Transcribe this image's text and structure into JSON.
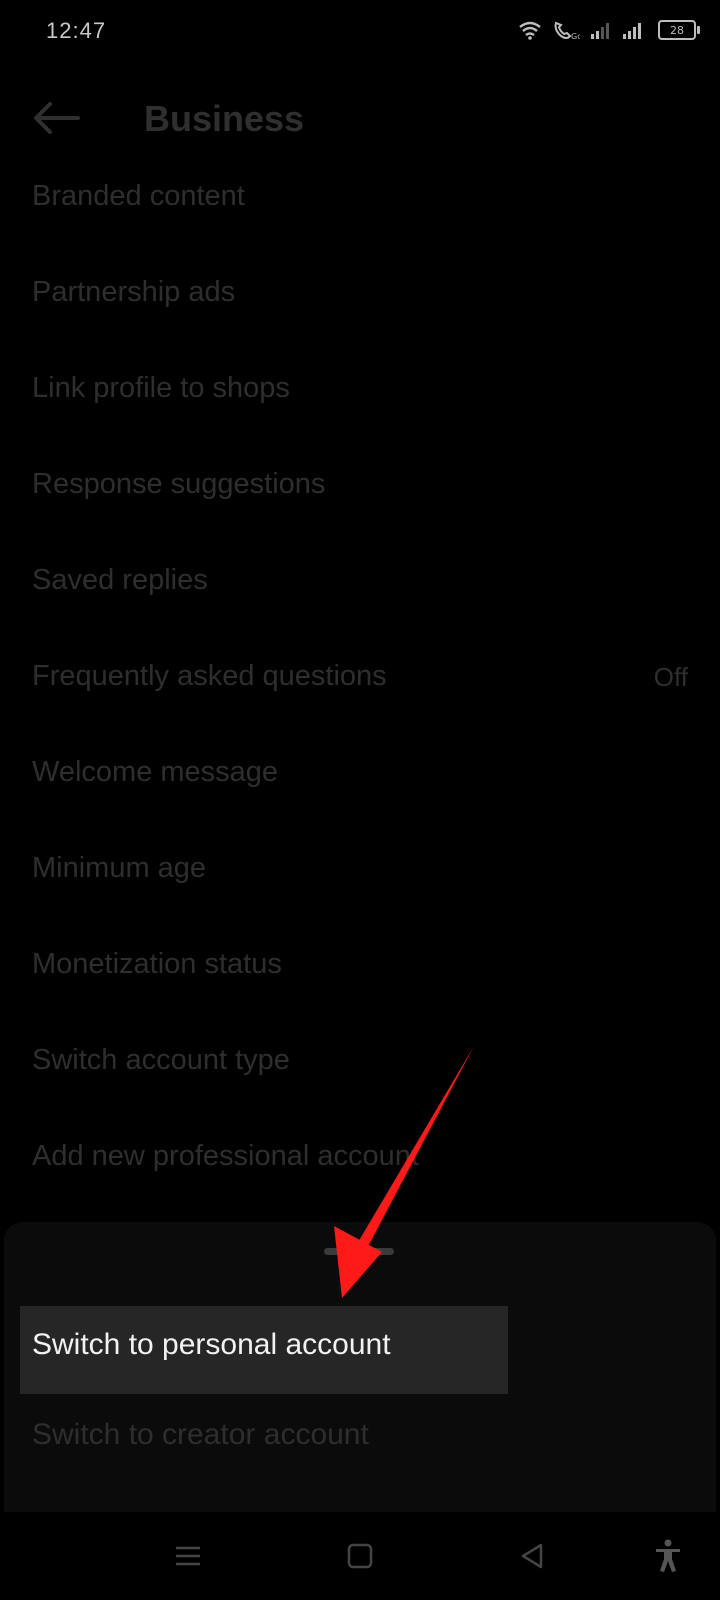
{
  "status_bar": {
    "time": "12:47",
    "battery": "28",
    "icons": [
      "wifi-icon",
      "volte-call-icon",
      "signal-icon",
      "signal-icon",
      "battery-icon"
    ]
  },
  "header": {
    "title": "Business",
    "back_icon": "arrow-left-icon"
  },
  "menu": {
    "items": [
      {
        "label": "Branded content"
      },
      {
        "label": "Partnership ads"
      },
      {
        "label": "Link profile to shops"
      },
      {
        "label": "Response suggestions"
      },
      {
        "label": "Saved replies"
      },
      {
        "label": "Frequently asked questions",
        "value": "Off"
      },
      {
        "label": "Welcome message"
      },
      {
        "label": "Minimum age"
      },
      {
        "label": "Monetization status"
      },
      {
        "label": "Switch account type"
      },
      {
        "label": "Add new professional account"
      }
    ]
  },
  "bottom_sheet": {
    "options": [
      {
        "label": "Switch to personal account"
      },
      {
        "label": "Switch to creator account"
      }
    ]
  },
  "annotation": {
    "color": "#ff1a1a"
  },
  "nav_bar": {
    "icons": [
      "menu-icon",
      "home-square-icon",
      "back-triangle-icon",
      "accessibility-icon"
    ]
  }
}
